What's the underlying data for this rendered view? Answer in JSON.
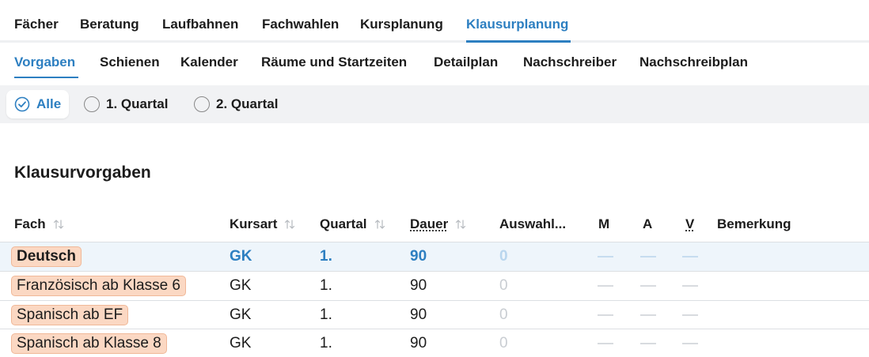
{
  "top_nav": {
    "items": [
      {
        "label": "Fächer",
        "active": false
      },
      {
        "label": "Beratung",
        "active": false
      },
      {
        "label": "Laufbahnen",
        "active": false
      },
      {
        "label": "Fachwahlen",
        "active": false
      },
      {
        "label": "Kursplanung",
        "active": false
      },
      {
        "label": "Klausurplanung",
        "active": true
      }
    ]
  },
  "sub_nav": {
    "items": [
      {
        "label": "Vorgaben",
        "active": true
      },
      {
        "label": "Schienen",
        "active": false
      },
      {
        "label": "Kalender",
        "active": false
      },
      {
        "label": "Räume und Startzeiten",
        "active": false
      },
      {
        "label": "Detailplan",
        "active": false
      },
      {
        "label": "Nachschreiber",
        "active": false
      },
      {
        "label": "Nachschreibplan",
        "active": false
      }
    ]
  },
  "filter": {
    "options": [
      {
        "label": "Alle",
        "selected": true,
        "icon": "check-circle-icon"
      },
      {
        "label": "1. Quartal",
        "selected": false,
        "icon": "radio-icon"
      },
      {
        "label": "2. Quartal",
        "selected": false,
        "icon": "radio-icon"
      }
    ]
  },
  "section_title": "Klausurvorgaben",
  "table": {
    "columns": {
      "fach": "Fach",
      "kursart": "Kursart",
      "quartal": "Quartal",
      "dauer": "Dauer",
      "auswahl": "Auswahl...",
      "m": "M",
      "a": "A",
      "v": "V",
      "bemerkung": "Bemerkung"
    },
    "rows": [
      {
        "fach": "Deutsch",
        "kursart": "GK",
        "quartal": "1.",
        "dauer": "90",
        "auswahl": "0",
        "selected": true
      },
      {
        "fach": "Französisch ab Klasse 6",
        "kursart": "GK",
        "quartal": "1.",
        "dauer": "90",
        "auswahl": "0",
        "selected": false
      },
      {
        "fach": "Spanisch ab EF",
        "kursart": "GK",
        "quartal": "1.",
        "dauer": "90",
        "auswahl": "0",
        "selected": false
      },
      {
        "fach": "Spanisch ab Klasse 8",
        "kursart": "GK",
        "quartal": "1.",
        "dauer": "90",
        "auswahl": "0",
        "selected": false
      }
    ]
  },
  "colors": {
    "accent": "#2d7fc1",
    "fach_pill": "#fbd8c3",
    "selected_row": "#eef5fb"
  }
}
